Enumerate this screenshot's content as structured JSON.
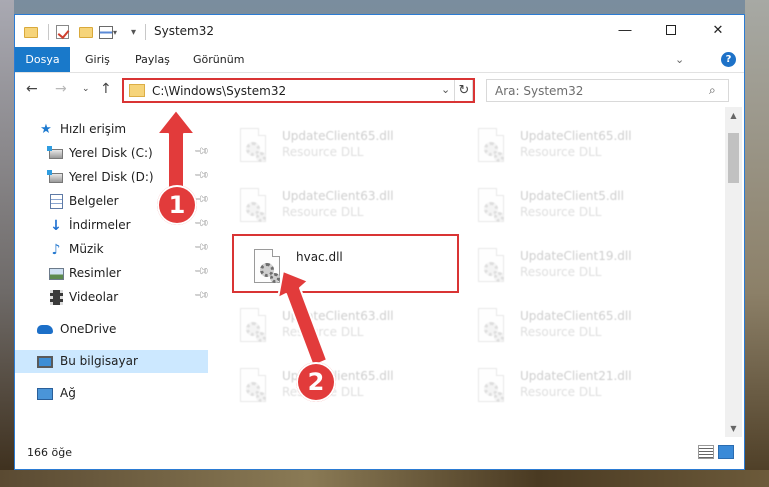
{
  "window": {
    "title": "System32"
  },
  "ribbon": {
    "tabs": [
      "Dosya",
      "Giriş",
      "Paylaş",
      "Görünüm"
    ]
  },
  "address": {
    "path": "C:\\Windows\\System32"
  },
  "search": {
    "placeholder": "Ara: System32"
  },
  "sidebar": {
    "items": [
      {
        "label": "Hızlı erişim",
        "icon": "star-icon"
      },
      {
        "label": "Yerel Disk (C:)",
        "icon": "drive-icon",
        "pinned": true
      },
      {
        "label": "Yerel Disk (D:)",
        "icon": "drive-icon",
        "pinned": true
      },
      {
        "label": "Belgeler",
        "icon": "documents-icon",
        "pinned": true
      },
      {
        "label": "İndirmeler",
        "icon": "download-icon",
        "pinned": true
      },
      {
        "label": "Müzik",
        "icon": "music-icon",
        "pinned": true
      },
      {
        "label": "Resimler",
        "icon": "pictures-icon",
        "pinned": true
      },
      {
        "label": "Videolar",
        "icon": "videos-icon",
        "pinned": true
      },
      {
        "label": "OneDrive",
        "icon": "onedrive-icon"
      },
      {
        "label": "Bu bilgisayar",
        "icon": "this-pc-icon",
        "selected": true
      },
      {
        "label": "Ağ",
        "icon": "network-icon"
      }
    ]
  },
  "files": {
    "left": [
      {
        "name": "UpdateClient65.dll",
        "type": "Resource DLL"
      },
      {
        "name": "UpdateClient63.dll",
        "type": "Resource DLL"
      },
      {
        "name": "hvac.dll",
        "type": ""
      },
      {
        "name": "UpdateClient63.dll",
        "type": "Resource DLL"
      },
      {
        "name": "UpdateClient65.dll",
        "type": "Resource DLL"
      }
    ],
    "right": [
      {
        "name": "UpdateClient65.dll",
        "type": "Resource DLL"
      },
      {
        "name": "UpdateClient5.dll",
        "type": "Resource DLL"
      },
      {
        "name": "UpdateClient19.dll",
        "type": "Resource DLL"
      },
      {
        "name": "UpdateClient65.dll",
        "type": "Resource DLL"
      },
      {
        "name": "UpdateClient21.dll",
        "type": "Resource DLL"
      }
    ]
  },
  "status": {
    "count": "166 öğe"
  },
  "annotations": {
    "step1": "1",
    "step2": "2"
  },
  "colors": {
    "accent": "#1979ca",
    "highlight": "#d93434",
    "selection": "#cce8ff"
  }
}
